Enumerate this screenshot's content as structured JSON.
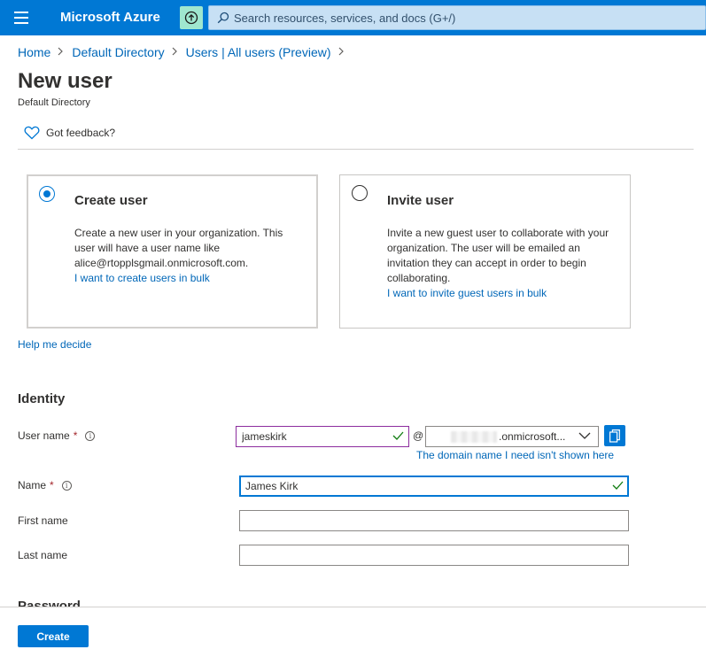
{
  "topbar": {
    "brand": "Microsoft Azure",
    "search_placeholder": "Search resources, services, and docs (G+/)",
    "accent_color": "#0078d4",
    "icons": [
      "hamburger-icon",
      "upload-icon",
      "search-icon"
    ]
  },
  "breadcrumb": {
    "items": [
      "Home",
      "Default Directory",
      "Users | All users (Preview)"
    ]
  },
  "page": {
    "title": "New user",
    "subtitle": "Default Directory"
  },
  "feedback": {
    "label": "Got feedback?"
  },
  "options": {
    "create": {
      "title": "Create user",
      "description": "Create a new user in your organization. This user will have a user name like alice@rtopplsgmail.onmicrosoft.com.",
      "link": "I want to create users in bulk",
      "selected": true
    },
    "invite": {
      "title": "Invite user",
      "description": "Invite a new guest user to collaborate with your organization. The user will be emailed an invitation they can accept in order to begin collaborating.",
      "link": "I want to invite guest users in bulk",
      "selected": false
    }
  },
  "help_link": "Help me decide",
  "identity": {
    "title": "Identity",
    "username": {
      "label": "User name",
      "required_mark": "*",
      "value": "jameskirk",
      "at": "@",
      "domain_value": ".onmicrosoft...",
      "domain_link": "The domain name I need isn't shown here"
    },
    "name": {
      "label": "Name",
      "required_mark": "*",
      "value": "James Kirk"
    },
    "first_name": {
      "label": "First name",
      "value": ""
    },
    "last_name": {
      "label": "Last name",
      "value": ""
    }
  },
  "password_section_title": "Password",
  "footer": {
    "create_label": "Create"
  }
}
